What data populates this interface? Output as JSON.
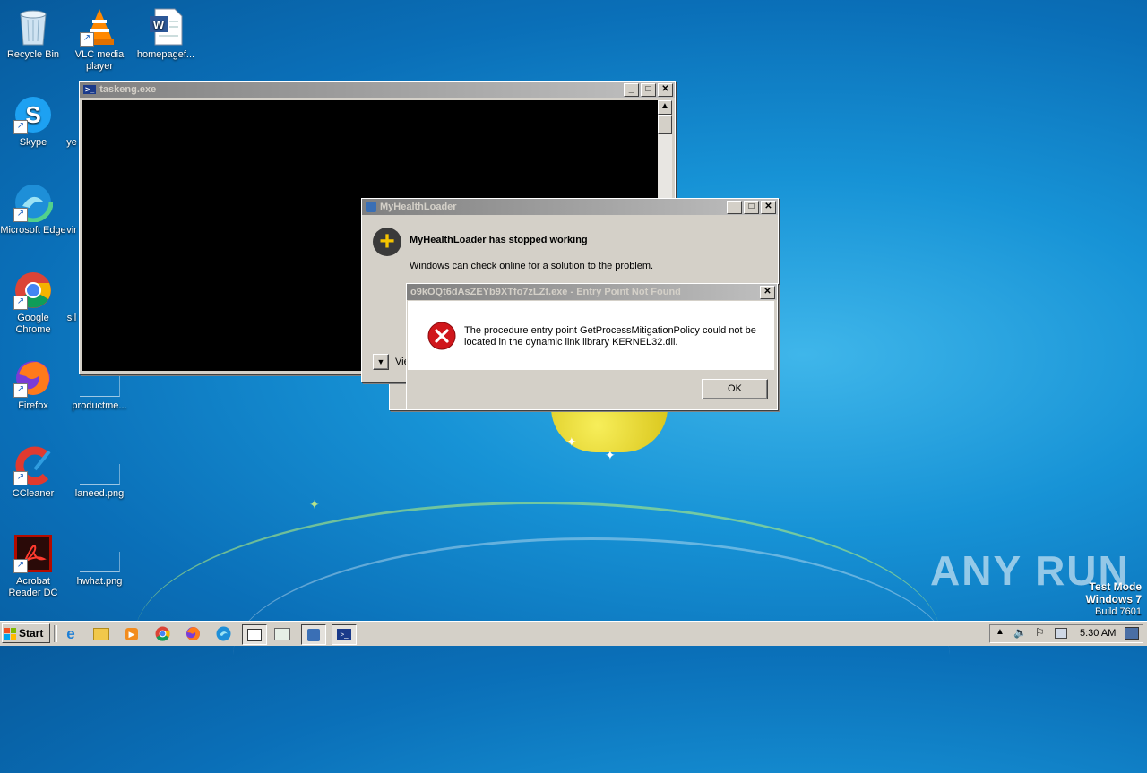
{
  "desktop": {
    "icons": [
      {
        "label": "Recycle Bin",
        "icon": "recycle-bin-icon"
      },
      {
        "label": "VLC media player",
        "icon": "vlc-icon"
      },
      {
        "label": "homepagef...",
        "icon": "word-document-icon"
      },
      {
        "label": "Skype",
        "icon": "skype-icon"
      },
      {
        "label": "ye",
        "icon": "file-icon"
      },
      {
        "label": "Microsoft Edge",
        "icon": "edge-icon"
      },
      {
        "label": "vir",
        "icon": "file-icon"
      },
      {
        "label": "Google Chrome",
        "icon": "chrome-icon"
      },
      {
        "label": "sil",
        "icon": "file-icon"
      },
      {
        "label": "Firefox",
        "icon": "firefox-icon"
      },
      {
        "label": "productme...",
        "icon": "file-icon"
      },
      {
        "label": "CCleaner",
        "icon": "ccleaner-icon"
      },
      {
        "label": "laneed.png",
        "icon": "image-file-icon"
      },
      {
        "label": "Acrobat Reader DC",
        "icon": "acrobat-icon"
      },
      {
        "label": "hwhat.png",
        "icon": "image-file-icon"
      }
    ]
  },
  "console_window": {
    "title": "taskeng.exe"
  },
  "crash_dialog": {
    "title": "MyHealthLoader",
    "heading": "MyHealthLoader has stopped working",
    "message": "Windows can check online for a solution to the problem.",
    "details_label": "Vie"
  },
  "error_dialog": {
    "title": "o9kOQt6dAsZEYb9XTfo7zLZf.exe - Entry Point Not Found",
    "message_line1": "The procedure entry point GetProcessMitigationPolicy could not be",
    "message_line2": "located in the dynamic link library KERNEL32.dll.",
    "ok_label": "OK"
  },
  "watermark": {
    "brand": "ANY RUN",
    "test_mode": "Test Mode",
    "os": "Windows 7",
    "build": "Build 7601"
  },
  "taskbar": {
    "start_label": "Start",
    "clock": "5:30 AM"
  },
  "colors": {
    "error_red": "#d0161b",
    "desktop_blue": "#1793d6"
  }
}
